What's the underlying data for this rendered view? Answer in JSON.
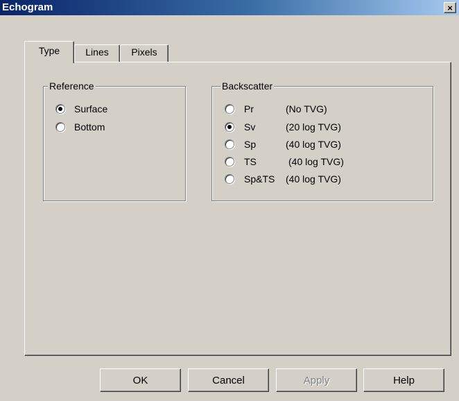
{
  "window": {
    "title": "Echogram",
    "close_glyph": "×"
  },
  "tabs": [
    {
      "label": "Type",
      "active": true
    },
    {
      "label": "Lines",
      "active": false
    },
    {
      "label": "Pixels",
      "active": false
    }
  ],
  "reference": {
    "label": "Reference",
    "options": [
      {
        "label": "Surface",
        "checked": true
      },
      {
        "label": "Bottom",
        "checked": false
      }
    ]
  },
  "backscatter": {
    "label": "Backscatter",
    "options": [
      {
        "label": "Pr",
        "desc": "(No TVG)",
        "checked": false
      },
      {
        "label": "Sv",
        "desc": "(20 log TVG)",
        "checked": true
      },
      {
        "label": "Sp",
        "desc": "(40 log TVG)",
        "checked": false
      },
      {
        "label": "TS",
        "desc": "(40 log TVG)",
        "checked": false
      },
      {
        "label": "Sp&TS",
        "desc": "(40 log TVG)",
        "checked": false
      }
    ]
  },
  "buttons": {
    "ok": "OK",
    "cancel": "Cancel",
    "apply": "Apply",
    "help": "Help"
  },
  "colors": {
    "titlebar_start": "#0a246a",
    "titlebar_end": "#a6caf0",
    "face": "#d4d0c8"
  }
}
